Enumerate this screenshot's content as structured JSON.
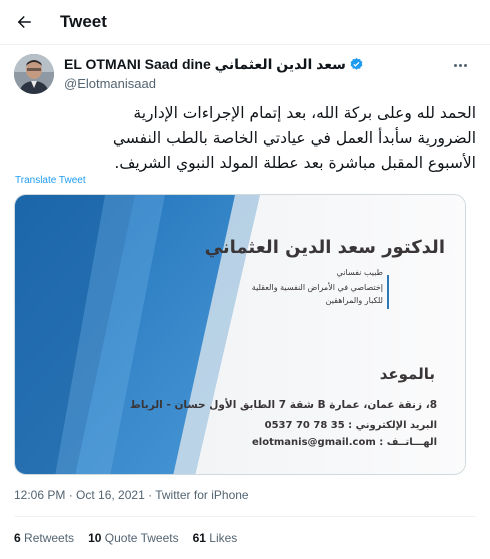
{
  "header": {
    "title": "Tweet"
  },
  "tweet": {
    "author_name": "EL OTMANI Saad dine سعد الدين العثماني",
    "handle": "@Elotmanisaad",
    "text_lines": [
      "الحمد لله وعلى بركة الله، بعد إتمام الإجراءات الإدارية",
      "الضرورية سأبدأ العمل في عيادتي الخاصة بالطب النفسي",
      "الأسبوع المقبل مباشرة بعد عطلة المولد النبوي الشريف."
    ],
    "translate_label": "Translate Tweet",
    "timestamp": "12:06 PM · Oct 16, 2021",
    "source": "Twitter for iPhone"
  },
  "card": {
    "name": "الدكتور سعد الدين العثماني",
    "title": "طبيب نفساني",
    "specialty_line1": "إختصاصي في الأمراض النفسية والعقلية",
    "specialty_line2": "للكبار والمراهقين",
    "appointment": "بالموعد",
    "address": "8، زنقة عمان، عمارة B شقة 7 الطابق الأول حسان - الرباط",
    "phone": "البريد الإلكتروني : 35 78 70 0537",
    "email": "elotmanis@gmail.com : الهـــاتــف"
  },
  "stats": {
    "retweets_count": "6",
    "retweets_label": "Retweets",
    "quotes_count": "10",
    "quotes_label": "Quote Tweets",
    "likes_count": "61",
    "likes_label": "Likes"
  },
  "colors": {
    "link": "#1d9bf0",
    "verified": "#1d9bf0",
    "card_blue": "#2f78b8"
  },
  "icons": {
    "back": "arrow-left-icon",
    "verified": "verified-badge-icon",
    "more": "more-dots-icon"
  }
}
